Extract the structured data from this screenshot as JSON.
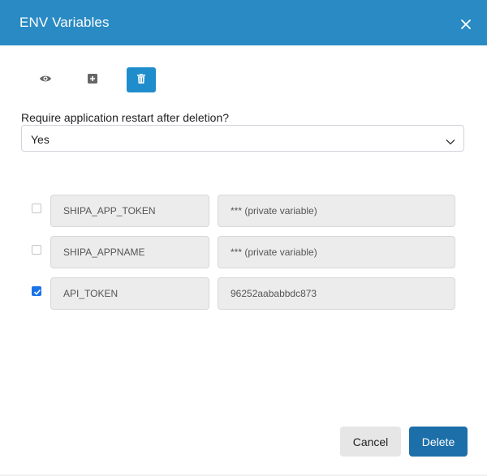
{
  "dialog": {
    "title": "ENV Variables",
    "header_color": "#2a8ac4"
  },
  "toolbar": {
    "buttons": [
      {
        "icon": "eye-icon",
        "active": false
      },
      {
        "icon": "plus-square-icon",
        "active": false
      },
      {
        "icon": "trash-icon",
        "active": true
      }
    ]
  },
  "restart": {
    "question": "Require application restart after deletion?",
    "selected": "Yes"
  },
  "variables": [
    {
      "checked": false,
      "key": "SHIPA_APP_TOKEN",
      "value": "*** (private variable)"
    },
    {
      "checked": false,
      "key": "SHIPA_APPNAME",
      "value": "*** (private variable)"
    },
    {
      "checked": true,
      "key": "API_TOKEN",
      "value": "96252aababbdc873"
    }
  ],
  "actions": {
    "cancel_label": "Cancel",
    "delete_label": "Delete",
    "delete_color": "#1c6fa9"
  }
}
